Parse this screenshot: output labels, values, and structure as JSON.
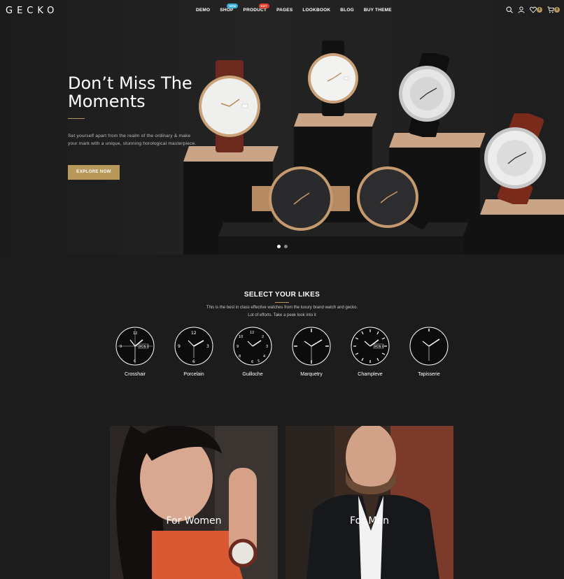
{
  "header": {
    "logo": "GECKO",
    "nav": [
      {
        "label": "DEMO",
        "badge": ""
      },
      {
        "label": "SHOP",
        "badge": "NEW"
      },
      {
        "label": "PRODUCT",
        "badge": "HOT"
      },
      {
        "label": "PAGES",
        "badge": ""
      },
      {
        "label": "LOOKBOOK",
        "badge": ""
      },
      {
        "label": "BLOG",
        "badge": ""
      },
      {
        "label": "BUY THEME",
        "badge": ""
      }
    ],
    "icons": [
      "search-icon",
      "user-icon",
      "heart-icon",
      "cart-icon"
    ],
    "wishlist_count": "0",
    "cart_count": "0"
  },
  "hero": {
    "title_line1": "Don’t Miss The",
    "title_line2": "Moments",
    "text": "Set yourself apart from the realm of the ordinary & make your mark with a unique, stunning horological masterpiece.",
    "button": "EXPLORE NOW",
    "slides": 2,
    "active_slide": 1
  },
  "likes": {
    "title": "SELECT YOUR LIKES",
    "subtitle_line1": "This is the best in class effective watches from the luxury brand watch and gecko.",
    "subtitle_line2": "Lot of efforts. Take a peek look into it",
    "dials": [
      {
        "label": "Crosshair"
      },
      {
        "label": "Porcelain"
      },
      {
        "label": "Guilloche"
      },
      {
        "label": "Marquetry"
      },
      {
        "label": "Champleve"
      },
      {
        "label": "Tapisserie"
      }
    ]
  },
  "categories": [
    {
      "label": "For Women"
    },
    {
      "label": "For Men"
    }
  ],
  "colors": {
    "accent": "#b9995a",
    "background": "#1c1c1c",
    "badge_new": "#3aaed8",
    "badge_hot": "#e0402b"
  }
}
